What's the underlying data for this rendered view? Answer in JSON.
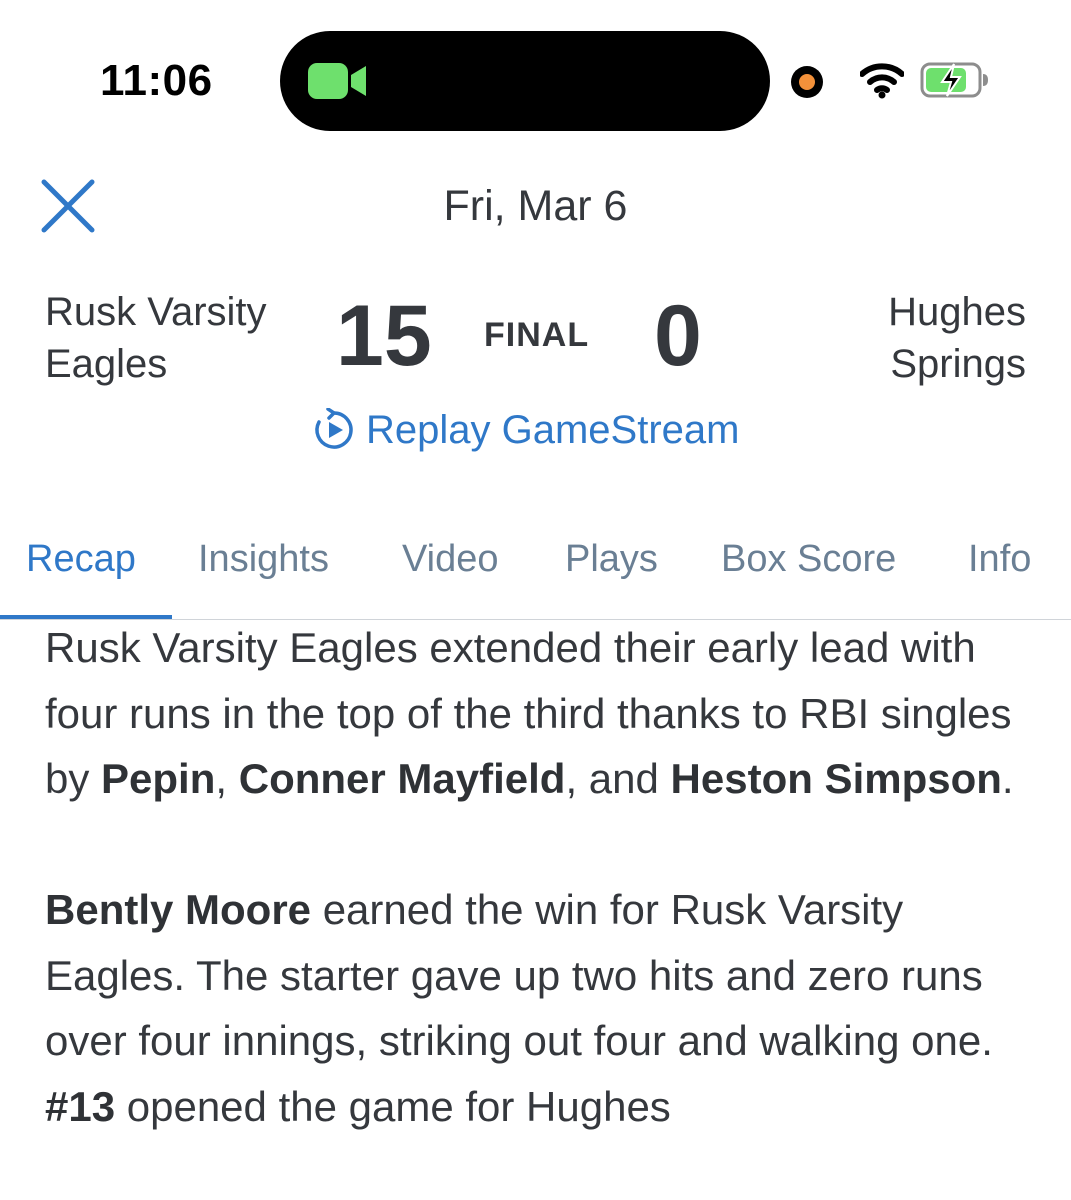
{
  "status_bar": {
    "time": "11:06",
    "icons": [
      "video-camera-icon",
      "orange-dot-icon",
      "wifi-icon",
      "battery-charging-icon"
    ],
    "camera_color": "#6ee06d",
    "dot_color": "#f3913a",
    "battery_color": "#6ee06d"
  },
  "header": {
    "close_icon": "close-icon",
    "date": "Fri, Mar 6"
  },
  "game": {
    "home_team_line1": "Rusk Varsity",
    "home_team_line2": "Eagles",
    "away_team_line1": "Hughes",
    "away_team_line2": "Springs",
    "home_score": "15",
    "away_score": "0",
    "status": "FINAL",
    "replay_label": "Replay GameStream",
    "replay_icon": "replay-icon"
  },
  "tabs": [
    {
      "label": "Recap",
      "active": true
    },
    {
      "label": "Insights",
      "active": false
    },
    {
      "label": "Video",
      "active": false
    },
    {
      "label": "Plays",
      "active": false
    },
    {
      "label": "Box Score",
      "active": false
    },
    {
      "label": "Info",
      "active": false
    }
  ],
  "recap": {
    "p1": {
      "t1": "Rusk Varsity Eagles extended their early lead with four runs in the top of the third thanks to RBI singles by ",
      "b1": "Pepin",
      "t2": ", ",
      "b2": "Conner Mayfield",
      "t3": ", and ",
      "b3": "Heston Simpson",
      "t4": "."
    },
    "p2": {
      "b1": "Bently Moore",
      "t1": " earned the win for Rusk Varsity Eagles. The starter gave up two hits and zero runs over four innings, striking out four and walking one. ",
      "b2": "#13",
      "t2": " opened the game for Hughes"
    }
  },
  "colors": {
    "accent": "#2f78c8",
    "text": "#35383d",
    "tab_inactive": "#6a7f94"
  }
}
